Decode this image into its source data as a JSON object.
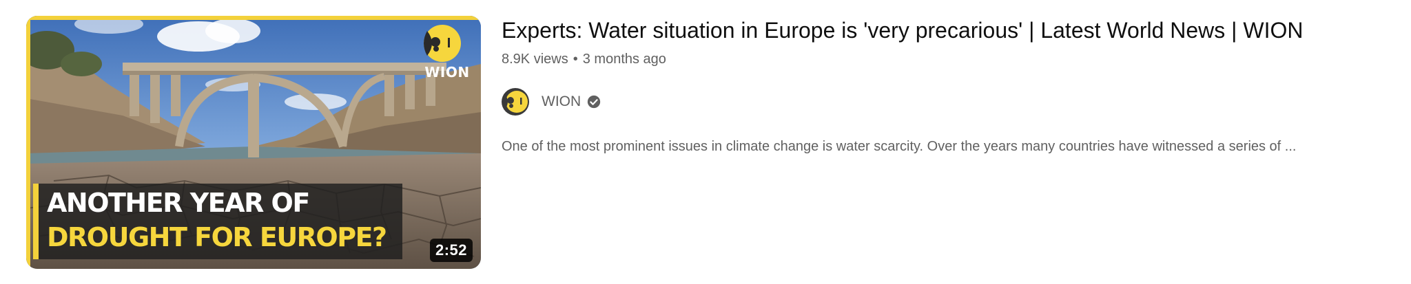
{
  "video": {
    "title": "Experts: Water situation in Europe is 'very precarious' | Latest World News | WION",
    "views": "8.9K views",
    "separator": "•",
    "age": "3 months ago",
    "duration": "2:52",
    "description": "One of the most prominent issues in climate change is water scarcity. Over the years many countries have witnessed a series of ...",
    "thumbnail": {
      "headline_line1": "ANOTHER YEAR OF",
      "headline_line2": "DROUGHT FOR EUROPE?",
      "logo_text": "WION",
      "accent_color": "#f6d63d"
    }
  },
  "channel": {
    "name": "WION",
    "verified": true,
    "avatar_icon": "wion-logo-icon",
    "verified_icon": "verified-check-icon"
  },
  "colors": {
    "title": "#0f0f0f",
    "secondary_text": "#606060",
    "brand_yellow": "#f3d13b",
    "background": "#ffffff"
  }
}
